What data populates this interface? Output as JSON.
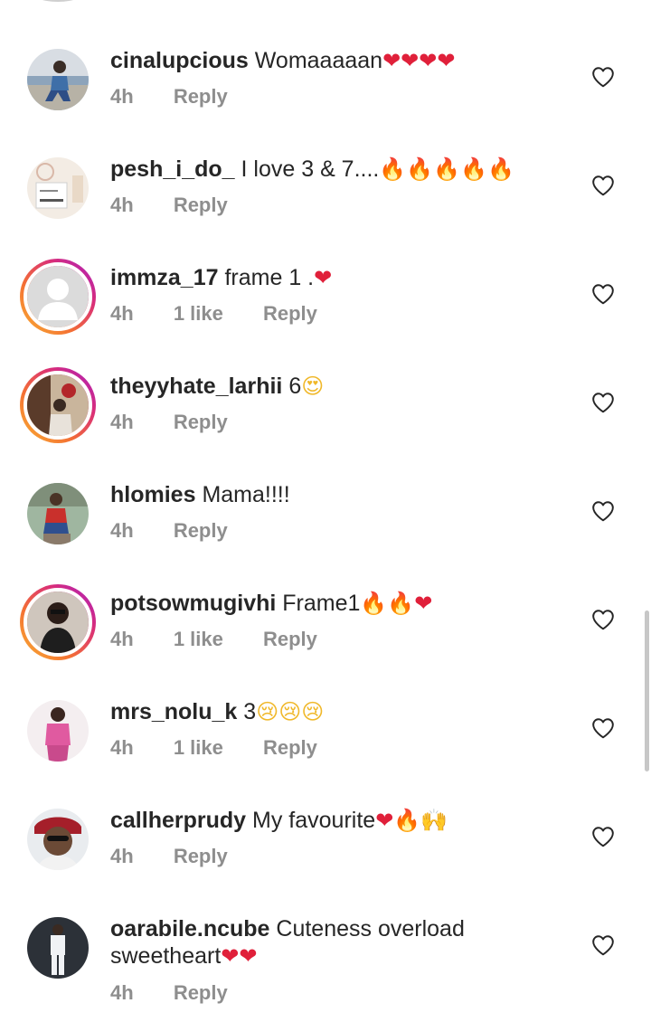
{
  "comments": [
    {
      "username": "cinalupcious",
      "text": "Womaaaaan",
      "emojis": [
        {
          "char": "❤",
          "kind": "heart"
        },
        {
          "char": "❤",
          "kind": "heart"
        },
        {
          "char": "❤",
          "kind": "heart"
        },
        {
          "char": "❤",
          "kind": "heart"
        }
      ],
      "time": "4h",
      "likes": "",
      "reply": "Reply",
      "story_ring": false
    },
    {
      "username": "pesh_i_do_",
      "text": "I love 3 & 7....",
      "emojis": [
        {
          "char": "🔥",
          "kind": "fire"
        },
        {
          "char": "🔥",
          "kind": "fire"
        },
        {
          "char": "🔥",
          "kind": "fire"
        },
        {
          "char": "🔥",
          "kind": "fire"
        },
        {
          "char": "🔥",
          "kind": "fire"
        }
      ],
      "time": "4h",
      "likes": "",
      "reply": "Reply",
      "story_ring": false
    },
    {
      "username": "immza_17",
      "text": "frame 1 .",
      "emojis": [
        {
          "char": "❤",
          "kind": "heart"
        }
      ],
      "time": "4h",
      "likes": "1 like",
      "reply": "Reply",
      "story_ring": true
    },
    {
      "username": "theyyhate_larhii",
      "text": "6",
      "emojis": [
        {
          "char": "😍",
          "kind": "face"
        }
      ],
      "time": "4h",
      "likes": "",
      "reply": "Reply",
      "story_ring": true
    },
    {
      "username": "hlomies",
      "text": "Mama!!!!",
      "emojis": [],
      "time": "4h",
      "likes": "",
      "reply": "Reply",
      "story_ring": false
    },
    {
      "username": "potsowmugivhi",
      "text": "Frame1",
      "emojis": [
        {
          "char": "🔥",
          "kind": "fire"
        },
        {
          "char": "🔥",
          "kind": "fire"
        },
        {
          "char": "❤",
          "kind": "heart"
        }
      ],
      "time": "4h",
      "likes": "1 like",
      "reply": "Reply",
      "story_ring": true
    },
    {
      "username": "mrs_nolu_k",
      "text": "3",
      "emojis": [
        {
          "char": "😢",
          "kind": "face"
        },
        {
          "char": "😢",
          "kind": "face"
        },
        {
          "char": "😢",
          "kind": "face"
        }
      ],
      "time": "4h",
      "likes": "1 like",
      "reply": "Reply",
      "story_ring": false
    },
    {
      "username": "callherprudy",
      "text": "My favourite",
      "emojis": [
        {
          "char": "❤",
          "kind": "heart"
        },
        {
          "char": "🔥",
          "kind": "fire"
        },
        {
          "char": "🙌",
          "kind": "hands"
        }
      ],
      "time": "4h",
      "likes": "",
      "reply": "Reply",
      "story_ring": false
    },
    {
      "username": "oarabile.ncube",
      "text": "Cuteness overload sweetheart",
      "emojis": [
        {
          "char": "❤",
          "kind": "heart"
        },
        {
          "char": "❤",
          "kind": "heart"
        }
      ],
      "time": "4h",
      "likes": "",
      "reply": "Reply",
      "story_ring": false
    }
  ],
  "icons": {
    "like": "heart-outline-icon"
  },
  "colors": {
    "username": "#262626",
    "meta": "#8e8e8e",
    "heart_emoji": "#e0203a",
    "fire_emoji": "#f36b1c"
  }
}
